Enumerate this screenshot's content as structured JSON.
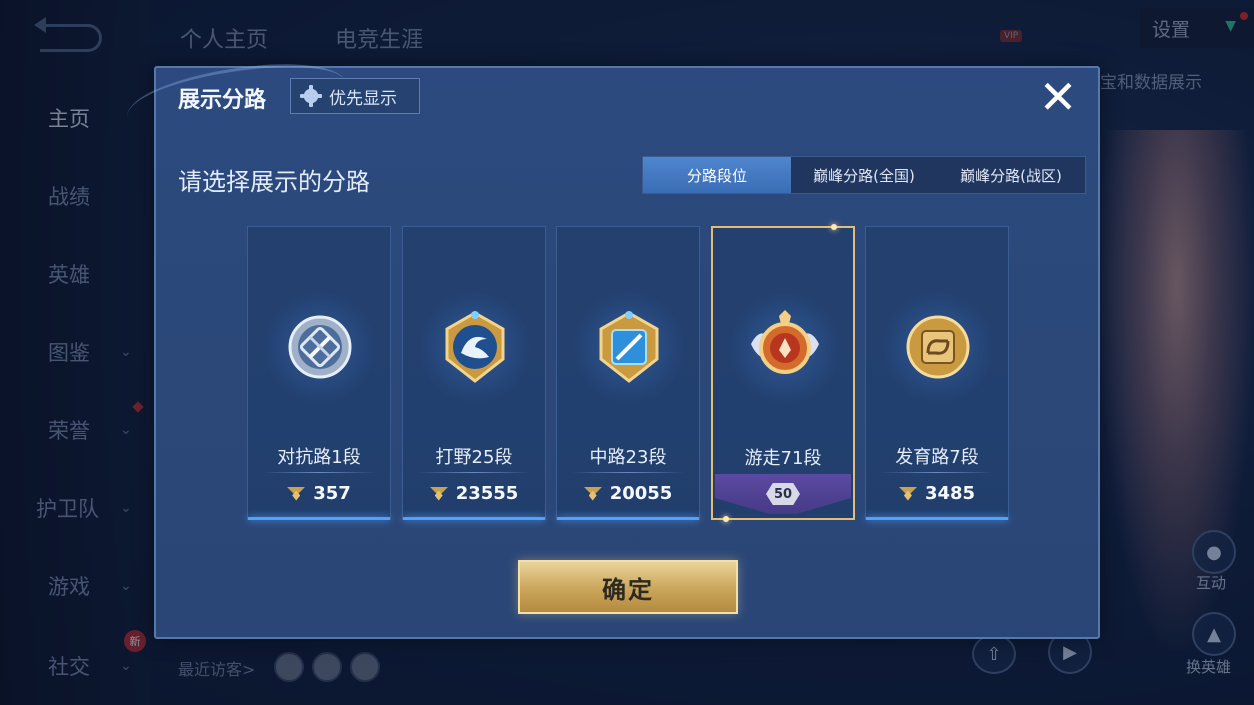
{
  "nav": {
    "items": [
      {
        "label": "主页",
        "chevron": false,
        "active": true
      },
      {
        "label": "战绩",
        "chevron": false
      },
      {
        "label": "英雄",
        "chevron": false
      },
      {
        "label": "图鉴",
        "chevron": true
      },
      {
        "label": "荣誉",
        "chevron": true
      },
      {
        "label": "护卫队",
        "chevron": true
      },
      {
        "label": "游戏",
        "chevron": true
      },
      {
        "label": "社交",
        "chevron": true
      }
    ],
    "new_badge": "新"
  },
  "top_tabs": [
    "个人主页",
    "电竞生涯"
  ],
  "settings_label": "设置",
  "vip_label": "VIP",
  "side_text": "宝和数据展示",
  "recent_visitors_label": "最近访客>",
  "right_buttons": {
    "interact": "互动",
    "change_hero": "换英雄"
  },
  "dialog": {
    "title": "展示分路",
    "priority_label": "优先显示",
    "prompt": "请选择展示的分路",
    "tabs": [
      "分路段位",
      "巅峰分路(全国)",
      "巅峰分路(战区)"
    ],
    "active_tab": 0,
    "lanes": [
      {
        "name": "对抗路1段",
        "score": "357",
        "medal": "silver",
        "selected": false
      },
      {
        "name": "打野25段",
        "score": "23555",
        "medal": "gold-dragon",
        "selected": false
      },
      {
        "name": "中路23段",
        "score": "20055",
        "medal": "gold-blue",
        "selected": false
      },
      {
        "name": "游走71段",
        "score": null,
        "peak_badge": "50",
        "medal": "red-wings",
        "selected": true
      },
      {
        "name": "发育路7段",
        "score": "3485",
        "medal": "gold",
        "selected": false
      }
    ],
    "confirm_label": "确定"
  },
  "colors": {
    "accent_gold": "#e3be72",
    "tab_active": "#4f86cf",
    "card_glow": "#4fa2ff"
  }
}
